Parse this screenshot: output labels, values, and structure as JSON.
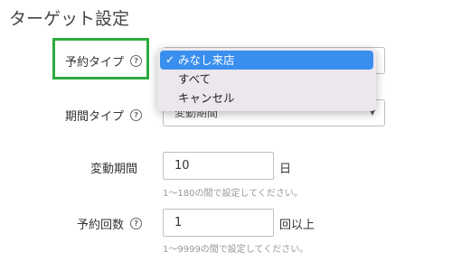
{
  "page": {
    "title": "ターゲット設定"
  },
  "reservation_type": {
    "label": "予約タイプ",
    "options": [
      {
        "label": "みなし来店",
        "selected": true
      },
      {
        "label": "すべて",
        "selected": false
      },
      {
        "label": "キャンセル",
        "selected": false
      }
    ]
  },
  "period_type": {
    "label": "期間タイプ",
    "value": "変動期間"
  },
  "variable_period": {
    "label": "変動期間",
    "value": "10",
    "unit": "日",
    "hint": "1〜180の間で設定してください。"
  },
  "reservation_count": {
    "label": "予約回数",
    "value": "1",
    "unit": "回以上",
    "hint": "1〜9999の間で設定してください。"
  },
  "icons": {
    "help": "?",
    "check": "✓",
    "chevron": "▼"
  },
  "colors": {
    "highlight_border": "#2eaa3e",
    "selected_option": "#3a8fee",
    "dropdown_bg": "#ece7ec"
  }
}
